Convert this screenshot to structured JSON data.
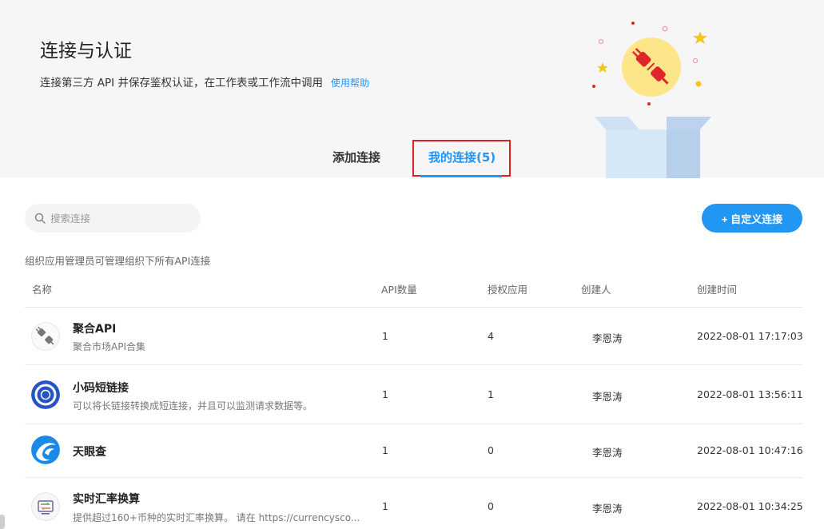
{
  "header": {
    "title": "连接与认证",
    "subtitle": "连接第三方 API 并保存鉴权认证，在工作表或工作流中调用",
    "help_link": "使用帮助"
  },
  "tabs": [
    {
      "label": "添加连接",
      "active": false
    },
    {
      "label": "我的连接(5)",
      "active": true
    }
  ],
  "toolbar": {
    "search_placeholder": "搜索连接",
    "add_button": "+ 自定义连接"
  },
  "note": "组织应用管理员可管理组织下所有API连接",
  "table": {
    "columns": [
      "名称",
      "API数量",
      "授权应用",
      "创建人",
      "创建时间"
    ],
    "rows": [
      {
        "name": "聚合API",
        "desc": "聚合市场API合集",
        "api_count": "1",
        "auth_apps": "4",
        "creator": "李恩涛",
        "created": "2022-08-01 17:17:03",
        "icon": "plug-icon"
      },
      {
        "name": "小码短链接",
        "desc": "可以将长链接转换成短连接，并且可以监测请求数据等。",
        "api_count": "1",
        "auth_apps": "1",
        "creator": "李恩涛",
        "created": "2022-08-01 13:56:11",
        "icon": "ring-logo-icon"
      },
      {
        "name": "天眼查",
        "desc": "",
        "api_count": "1",
        "auth_apps": "0",
        "creator": "李恩涛",
        "created": "2022-08-01 10:47:16",
        "icon": "wave-logo-icon"
      },
      {
        "name": "实时汇率换算",
        "desc": "提供超过160+币种的实时汇率换算。 请在 https://currencysco...",
        "api_count": "1",
        "auth_apps": "0",
        "creator": "李恩涛",
        "created": "2022-08-01 10:34:25",
        "icon": "currency-exchange-icon"
      }
    ]
  },
  "colors": {
    "accent": "#2196f3",
    "highlight_border": "#e02020",
    "banner_bg": "#f6f6f7"
  }
}
